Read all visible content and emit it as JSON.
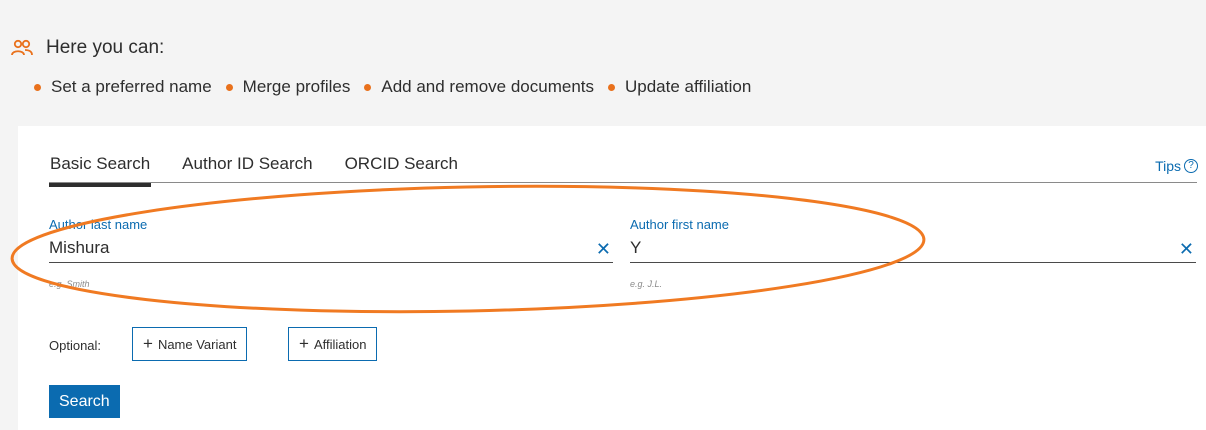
{
  "intro": {
    "title": "Here you can:",
    "bullets": [
      "Set a preferred name",
      "Merge profiles",
      "Add and remove documents",
      "Update affiliation"
    ],
    "icon": "people-icon",
    "accent_color": "#e9711c"
  },
  "tabs": [
    {
      "label": "Basic Search",
      "active": true
    },
    {
      "label": "Author ID Search",
      "active": false
    },
    {
      "label": "ORCID Search",
      "active": false
    }
  ],
  "tips": {
    "label": "Tips",
    "icon": "help-circle-icon"
  },
  "fields": {
    "last_name": {
      "label": "Author last name",
      "value": "Mishura",
      "hint": "e.g. Smith"
    },
    "first_name": {
      "label": "Author first name",
      "value": "Y",
      "hint": "e.g. J.L."
    }
  },
  "optional": {
    "label": "Optional:",
    "name_variant": "Name Variant",
    "affiliation": "Affiliation"
  },
  "search": {
    "label": "Search"
  },
  "colors": {
    "link": "#0b6bb0",
    "annotation": "#f07a22"
  }
}
